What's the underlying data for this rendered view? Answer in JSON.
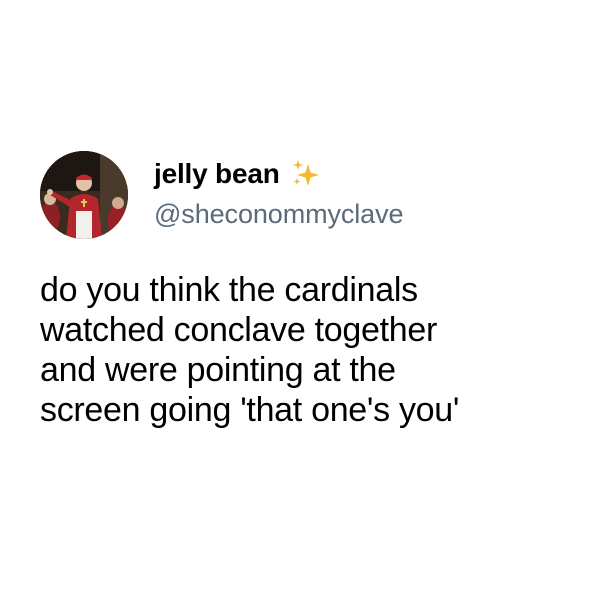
{
  "tweet": {
    "author": {
      "display_name": "jelly bean",
      "handle": "@sheconommyclave",
      "badge_icon": "sparkles-icon",
      "avatar_icon": "cardinal-photo"
    },
    "text_lines": [
      "do you think the cardinals",
      "watched conclave together",
      "and were pointing at the",
      "screen going 'that one's you'"
    ]
  },
  "colors": {
    "background": "#ffffff",
    "text": "#000000",
    "handle": "#5b6b79",
    "sparkle": "#f5b82e"
  }
}
